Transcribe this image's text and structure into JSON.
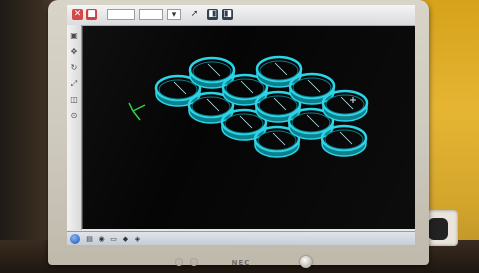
{
  "photo": {
    "subject": "monitor displaying a 3D modeling application",
    "monitor_brand": "NEC"
  },
  "toolbar": {
    "buttons": [
      "close",
      "stop",
      "field-a",
      "field-b",
      "dropdown",
      "pointer",
      "view-a",
      "view-b"
    ]
  },
  "side_toolbar": {
    "buttons": [
      "select",
      "move",
      "rotate",
      "scale",
      "view",
      "camera"
    ]
  },
  "viewport": {
    "background_color": "#050506",
    "ring_color": "#2ad4e6",
    "ring_dark_color": "#0a7f8c",
    "axis_gizmo_color": "#33cc44",
    "rings": [
      {
        "row": 0,
        "col": 0
      },
      {
        "row": 0,
        "col": 1
      },
      {
        "row": 1,
        "col": 0
      },
      {
        "row": 1,
        "col": 1
      },
      {
        "row": 1,
        "col": 2
      },
      {
        "row": 2,
        "col": 0
      },
      {
        "row": 2,
        "col": 1
      },
      {
        "row": 2,
        "col": 2
      },
      {
        "row": 3,
        "col": 0
      },
      {
        "row": 3,
        "col": 1
      },
      {
        "row": 3,
        "col": 2
      },
      {
        "row": 4,
        "col": 1
      }
    ]
  },
  "taskbar": {
    "tray_text": "",
    "icons": [
      "explorer",
      "browser",
      "folder",
      "app",
      "app-active"
    ]
  }
}
